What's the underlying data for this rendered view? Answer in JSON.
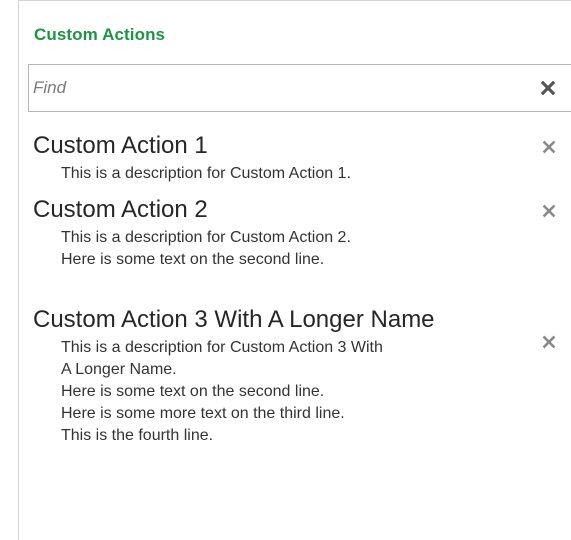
{
  "panel": {
    "title": "Custom Actions"
  },
  "search": {
    "placeholder": "Find",
    "value": "",
    "clear_icon": "close-icon"
  },
  "actions": [
    {
      "name": "Custom Action 1",
      "description_lines": [
        "This is a description for Custom Action 1."
      ],
      "remove_icon": "close-icon"
    },
    {
      "name": "Custom Action 2",
      "description_lines": [
        "This is a description for Custom Action 2.",
        "Here is some text on the second line."
      ],
      "remove_icon": "close-icon"
    },
    {
      "name": "Custom Action 3 With A Longer Name",
      "description_lines": [
        "This is a description for Custom Action 3 With",
        "A Longer Name.",
        "Here is some text on the second line.",
        "Here is some more text on the third line.",
        "This is the fourth line."
      ],
      "remove_icon": "close-icon"
    }
  ],
  "colors": {
    "title_green": "#1f9442",
    "text": "#262626",
    "icon_gray": "#7f7f7f",
    "border": "#b5b5b5"
  }
}
